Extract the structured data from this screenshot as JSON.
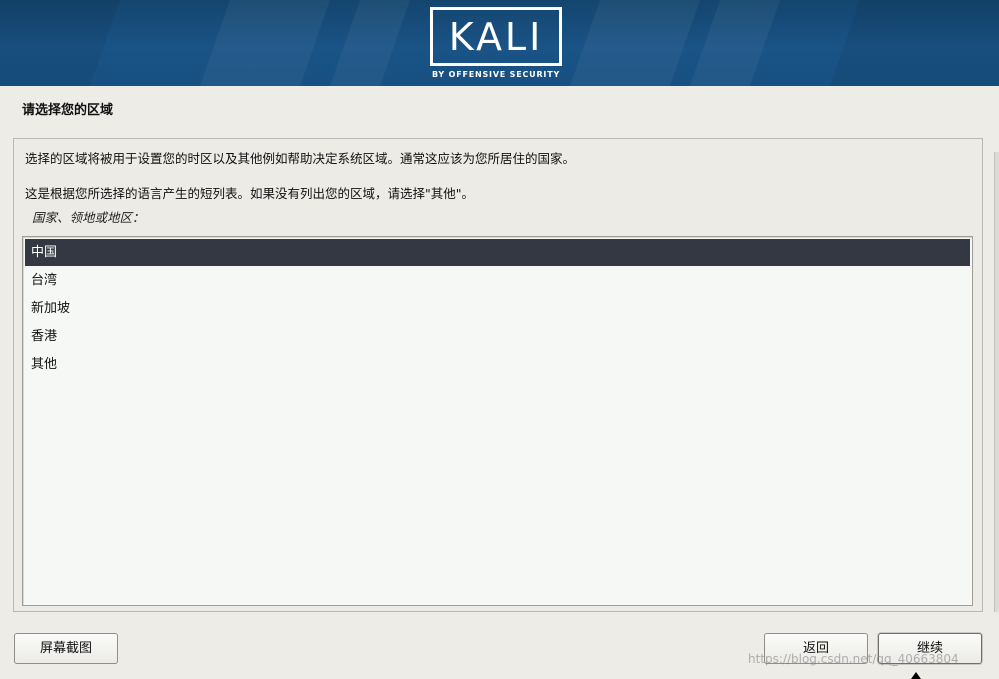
{
  "banner": {
    "logo_text": "KALI",
    "logo_subtitle": "BY OFFENSIVE SECURITY"
  },
  "page": {
    "title": "请选择您的区域"
  },
  "content": {
    "description_1": "选择的区域将被用于设置您的时区以及其他例如帮助决定系统区域。通常这应该为您所居住的国家。",
    "description_2": "这是根据您所选择的语言产生的短列表。如果没有列出您的区域，请选择\"其他\"。",
    "list_label": "国家、领地或地区：",
    "options": [
      {
        "label": "中国",
        "selected": true
      },
      {
        "label": "台湾",
        "selected": false
      },
      {
        "label": "新加坡",
        "selected": false
      },
      {
        "label": "香港",
        "selected": false
      },
      {
        "label": "其他",
        "selected": false
      }
    ]
  },
  "buttons": {
    "screenshot": "屏幕截图",
    "back": "返回",
    "continue": "继续"
  },
  "watermark": "https://blog.csdn.net/qq_40663804",
  "colors": {
    "banner": "#1a5386",
    "selected_row": "#333843",
    "page_bg": "#edece6",
    "list_bg": "#f5f8f5"
  }
}
